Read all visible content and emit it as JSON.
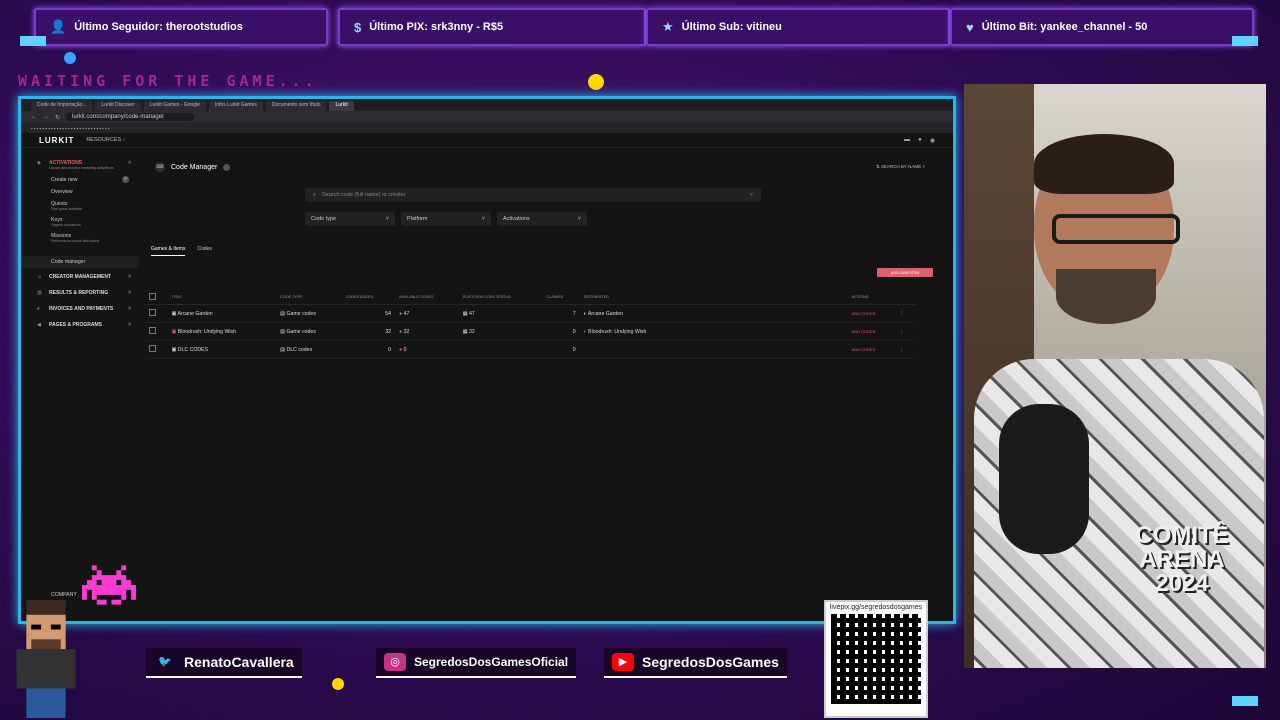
{
  "alerts": [
    {
      "label": "Último Seguidor: therootstudios",
      "icon": "user-icon"
    },
    {
      "label": "Último PIX: srk3nny - R$5",
      "icon": "dollar-icon"
    },
    {
      "label": "Último Sub: vitineu",
      "icon": "star-icon"
    },
    {
      "label": "Último Bit: yankee_channel - 50",
      "icon": "heart-icon"
    }
  ],
  "waiting_text": "WAITING FOR THE GAME...",
  "browser": {
    "tabs": [
      "Code de Importação...",
      "Lurkit Discover",
      "Lurkit Games - Google",
      "Infos Lurkit Games",
      "Documento sem título",
      "Lurkit"
    ],
    "url": "lurkit.com/company/code-manager"
  },
  "app": {
    "logo": "LURKIT",
    "nav_resources": "RESOURCES",
    "sidebar": {
      "activations_title": "ACTIVATIONS",
      "activations_sub": "Launch and monitor marketing activations",
      "create_new": "Create new",
      "overview": "Overview",
      "quests": "Quests",
      "quests_sub": "Find quest activities",
      "keys": "Keys",
      "keys_sub": "Organic activations",
      "missions": "Missions",
      "missions_sub": "Performance-based activations",
      "code_manager": "Code manager",
      "creator_management": "CREATOR MANAGEMENT",
      "results_reporting": "RESULTS & REPORTING",
      "invoices_payments": "INVOICES AND PAYMENTS",
      "pages_programs": "PAGES & PROGRAMS",
      "company": "COMPANY"
    },
    "page_title": "Code Manager",
    "sort_label": "SEARCH BY NAME",
    "search_placeholder": "Search code (full name) or creator",
    "filters": [
      "Code type",
      "Platform",
      "Activations"
    ],
    "tabs": [
      "Games & Items",
      "Codes"
    ],
    "add_button": "ADD GAME/ITEM",
    "columns": [
      "TITLE",
      "CODE TYPE",
      "CODES ADDED",
      "AVAILABLE CODES",
      "PLATFORM CODE STATUS",
      "CLAIMED",
      "DISTRIBUTED",
      "ACTIONS"
    ],
    "rows": [
      {
        "title": "Arcane Garden",
        "type": "Game codes",
        "added": "54",
        "available": "47",
        "platform": "47",
        "claimed": "7",
        "distributed": "Arcane Garden",
        "action": "ADD CODES"
      },
      {
        "title": "Bloodrush: Undying Wish",
        "type": "Game codes",
        "added": "32",
        "available": "32",
        "platform": "32",
        "claimed": "0",
        "distributed": "Bloodrush: Undying Wish",
        "action": "ADD CODES"
      },
      {
        "title": "DLC CODES",
        "type": "DLC codes",
        "added": "0",
        "available": "0",
        "platform": "",
        "claimed": "0",
        "distributed": "",
        "action": "ADD CODES"
      }
    ]
  },
  "shirt_text": "COMITÊ ARENA 2024",
  "socials": [
    {
      "label": "RenatoCavallera",
      "icon": "twitter-icon",
      "color": "#1da1f2"
    },
    {
      "label": "SegredosDosGamesOficial",
      "icon": "instagram-icon",
      "color": "#c13584"
    },
    {
      "label": "SegredosDosGames",
      "icon": "youtube-icon",
      "color": "#ff0000"
    }
  ],
  "qr_label": "livepix.gg/segredosdosgames"
}
